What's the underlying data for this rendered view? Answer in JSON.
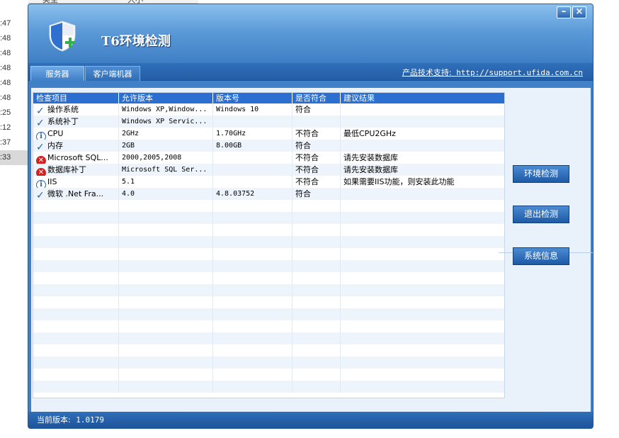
{
  "background": {
    "times": [
      ":47",
      ":48",
      ":48",
      ":48",
      ":48",
      ":48",
      ":25",
      ":12",
      ":37",
      ":33"
    ],
    "header_fragment": [
      "类型",
      "大小"
    ]
  },
  "window": {
    "title": "T6环境检测",
    "minimize_label": "–",
    "close_label": "×"
  },
  "tabs": [
    {
      "label": "服务器"
    },
    {
      "label": "客户端机器"
    }
  ],
  "support": {
    "label": "产品技术支持:",
    "url": "http://support.ufida.com.cn"
  },
  "grid": {
    "columns": [
      "检查项目",
      "允许版本",
      "版本号",
      "是否符合",
      "建议结果"
    ],
    "rows": [
      {
        "status": "check",
        "item": "操作系统",
        "allowed": "Windows XP,Window...",
        "version": "Windows 10",
        "ok": "符合",
        "advice": ""
      },
      {
        "status": "check",
        "item": "系统补丁",
        "allowed": "Windows XP Servic...",
        "version": "",
        "ok": "",
        "advice": ""
      },
      {
        "status": "info",
        "item": "CPU",
        "allowed": "2GHz",
        "version": "1.70GHz",
        "ok": "不符合",
        "advice": "最低CPU2GHz"
      },
      {
        "status": "check",
        "item": "内存",
        "allowed": "2GB",
        "version": "8.00GB",
        "ok": "符合",
        "advice": ""
      },
      {
        "status": "error",
        "item": "Microsoft SQL...",
        "allowed": "2000,2005,2008",
        "version": "",
        "ok": "不符合",
        "advice": "请先安装数据库"
      },
      {
        "status": "error",
        "item": "数据库补丁",
        "allowed": "Microsoft SQL Ser...",
        "version": "",
        "ok": "不符合",
        "advice": "请先安装数据库"
      },
      {
        "status": "info",
        "item": "IIS",
        "allowed": "5.1",
        "version": "",
        "ok": "不符合",
        "advice": "如果需要IIS功能，则安装此功能"
      },
      {
        "status": "check",
        "item": "微软 .Net Fra...",
        "allowed": "4.0",
        "version": "4.8.03752",
        "ok": "符合",
        "advice": ""
      }
    ]
  },
  "buttons": {
    "env_check": "环境检测",
    "exit_check": "退出检测",
    "sys_info": "系统信息"
  },
  "status": {
    "label": "当前版本:",
    "version": "1.0179"
  },
  "colors": {
    "header_blue": "#2b6fd0",
    "window_blue": "#3f80c6",
    "error_red": "#d42020"
  }
}
